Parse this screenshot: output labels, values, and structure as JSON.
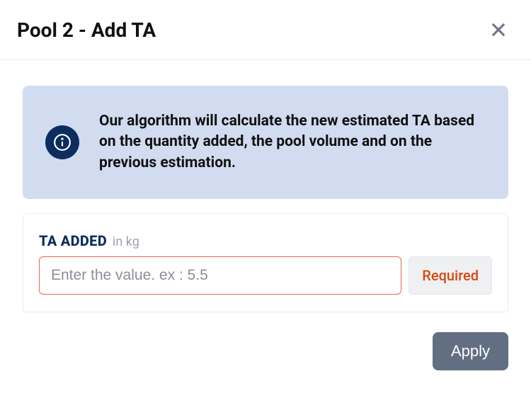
{
  "header": {
    "title": "Pool 2 - Add TA"
  },
  "info": {
    "text": "Our algorithm will calculate the new estimated TA based on the quantity added, the pool volume and on the previous estimation."
  },
  "form": {
    "label": "TA ADDED",
    "unit": "in kg",
    "placeholder": "Enter the value. ex : 5.5",
    "value": "",
    "validation_text": "Required"
  },
  "footer": {
    "apply_label": "Apply"
  }
}
